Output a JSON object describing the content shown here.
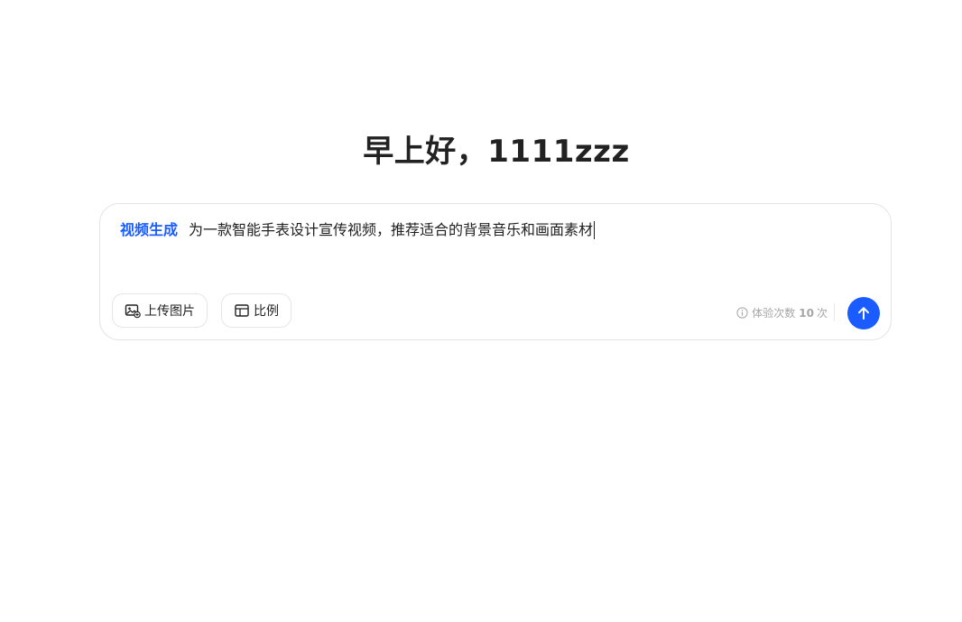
{
  "greeting": "早上好，1111zzz",
  "composer": {
    "mode_tag": "视频生成",
    "prompt_text": "为一款智能手表设计宣传视频，推荐适合的背景音乐和画面素材",
    "tools": [
      {
        "label": "上传图片",
        "icon": "image-upload-icon"
      },
      {
        "label": "比例",
        "icon": "layout-ratio-icon"
      }
    ],
    "quota": {
      "label": "体验次数",
      "count": "10",
      "unit": "次",
      "icon": "info-icon"
    },
    "send_icon": "arrow-up-icon"
  },
  "colors": {
    "accent": "#1a5cff",
    "text": "#1f1f1f",
    "muted": "#a6a6a6",
    "border": "#e3e3e3"
  }
}
